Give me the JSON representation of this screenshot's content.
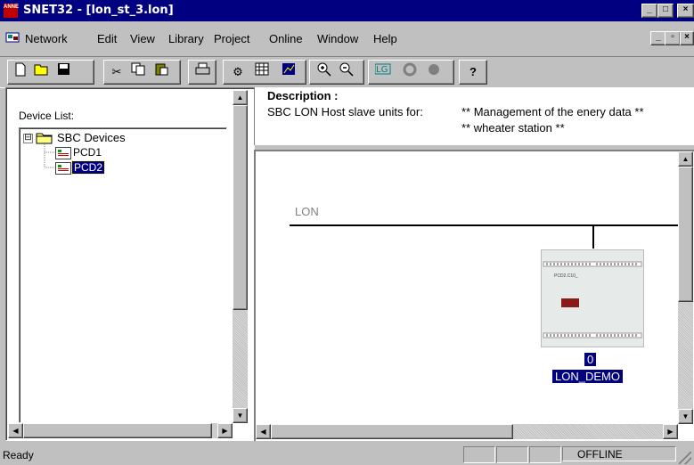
{
  "window": {
    "title": "SNET32 - [lon_st_3.lon]",
    "app_icon_text": "ANNE",
    "min": "_",
    "max": "□",
    "close": "×"
  },
  "menu": {
    "items": [
      "Network",
      "Edit",
      "View",
      "Library",
      "Project",
      "Online",
      "Window",
      "Help"
    ],
    "child_min": "_",
    "child_restore": "▫",
    "child_close": "×"
  },
  "toolbar": {
    "icons": [
      "new-icon",
      "open-icon",
      "save-icon",
      "cut-icon",
      "copy-icon",
      "paste-icon",
      "print-icon",
      "settings-icon",
      "grid-icon",
      "chart-icon",
      "zoom-in-icon",
      "zoom-out-icon",
      "lon-icon",
      "refresh-icon",
      "stop-icon",
      "help-icon"
    ]
  },
  "left_pane": {
    "label": "Device List:",
    "tree": {
      "root": "SBC Devices",
      "root_expander": "⊟",
      "children": [
        "PCD1",
        "PCD2"
      ],
      "selected_index": 1
    }
  },
  "description": {
    "heading": "Description :",
    "prefix": "SBC LON Host slave units for:",
    "line1": "**  Management of the enery data **",
    "line2": "**  wheater station  **"
  },
  "network": {
    "bus_label": "LON",
    "device": {
      "model": "PCD2.C10_",
      "address": "0",
      "name": "LON_DEMO"
    }
  },
  "status": {
    "text": "Ready",
    "mode": "OFFLINE"
  },
  "colors": {
    "title_bar": "#000080",
    "selection": "#000080",
    "face": "#c0c0c0"
  }
}
